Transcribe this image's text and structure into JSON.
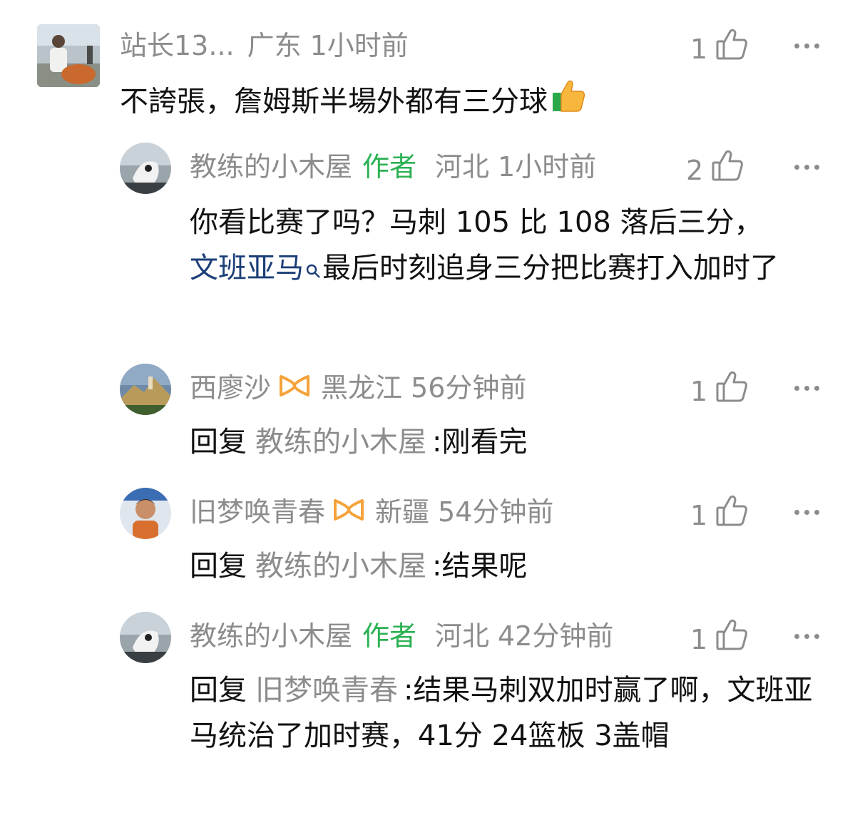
{
  "comments": [
    {
      "user": "站长13...",
      "region": "广东",
      "time": "1小时前",
      "likes": "1",
      "text": "不誇張，詹姆斯半場外都有三分球"
    },
    {
      "user": "教练的小木屋",
      "author_tag": "作者",
      "region": "河北",
      "time": "1小时前",
      "likes": "2",
      "text_a": "你看比赛了吗？马刺 105 比 108 落后三分，",
      "link": "文班亚马",
      "text_b": "最后时刻追身三分把比赛打入加时了"
    },
    {
      "user": "西廖沙",
      "region": "黑龙江",
      "time": "56分钟前",
      "likes": "1",
      "reply_prefix": "回复",
      "reply_to": "教练的小木屋",
      "text": ":刚看完"
    },
    {
      "user": "旧梦唤青春",
      "region": "新疆",
      "time": "54分钟前",
      "likes": "1",
      "reply_prefix": "回复",
      "reply_to": "教练的小木屋",
      "text": ":结果呢"
    },
    {
      "user": "教练的小木屋",
      "author_tag": "作者",
      "region": "河北",
      "time": "42分钟前",
      "likes": "1",
      "reply_prefix": "回复",
      "reply_to": "旧梦唤青春",
      "text": ":结果马刺双加时赢了啊，文班亚马统治了加时赛，41分 24篮板 3盖帽"
    }
  ],
  "icons": {
    "like": "thumbs-up-outline-icon",
    "more": "more-dots-icon",
    "badge": "orange-infinity-badge-icon",
    "search": "search-icon",
    "emoji": "thumbs-up-emoji-icon"
  },
  "colors": {
    "meta": "#8c8c8c",
    "author_tag": "#2bb153",
    "link": "#1c3f78",
    "badge": "#f5a33a"
  }
}
